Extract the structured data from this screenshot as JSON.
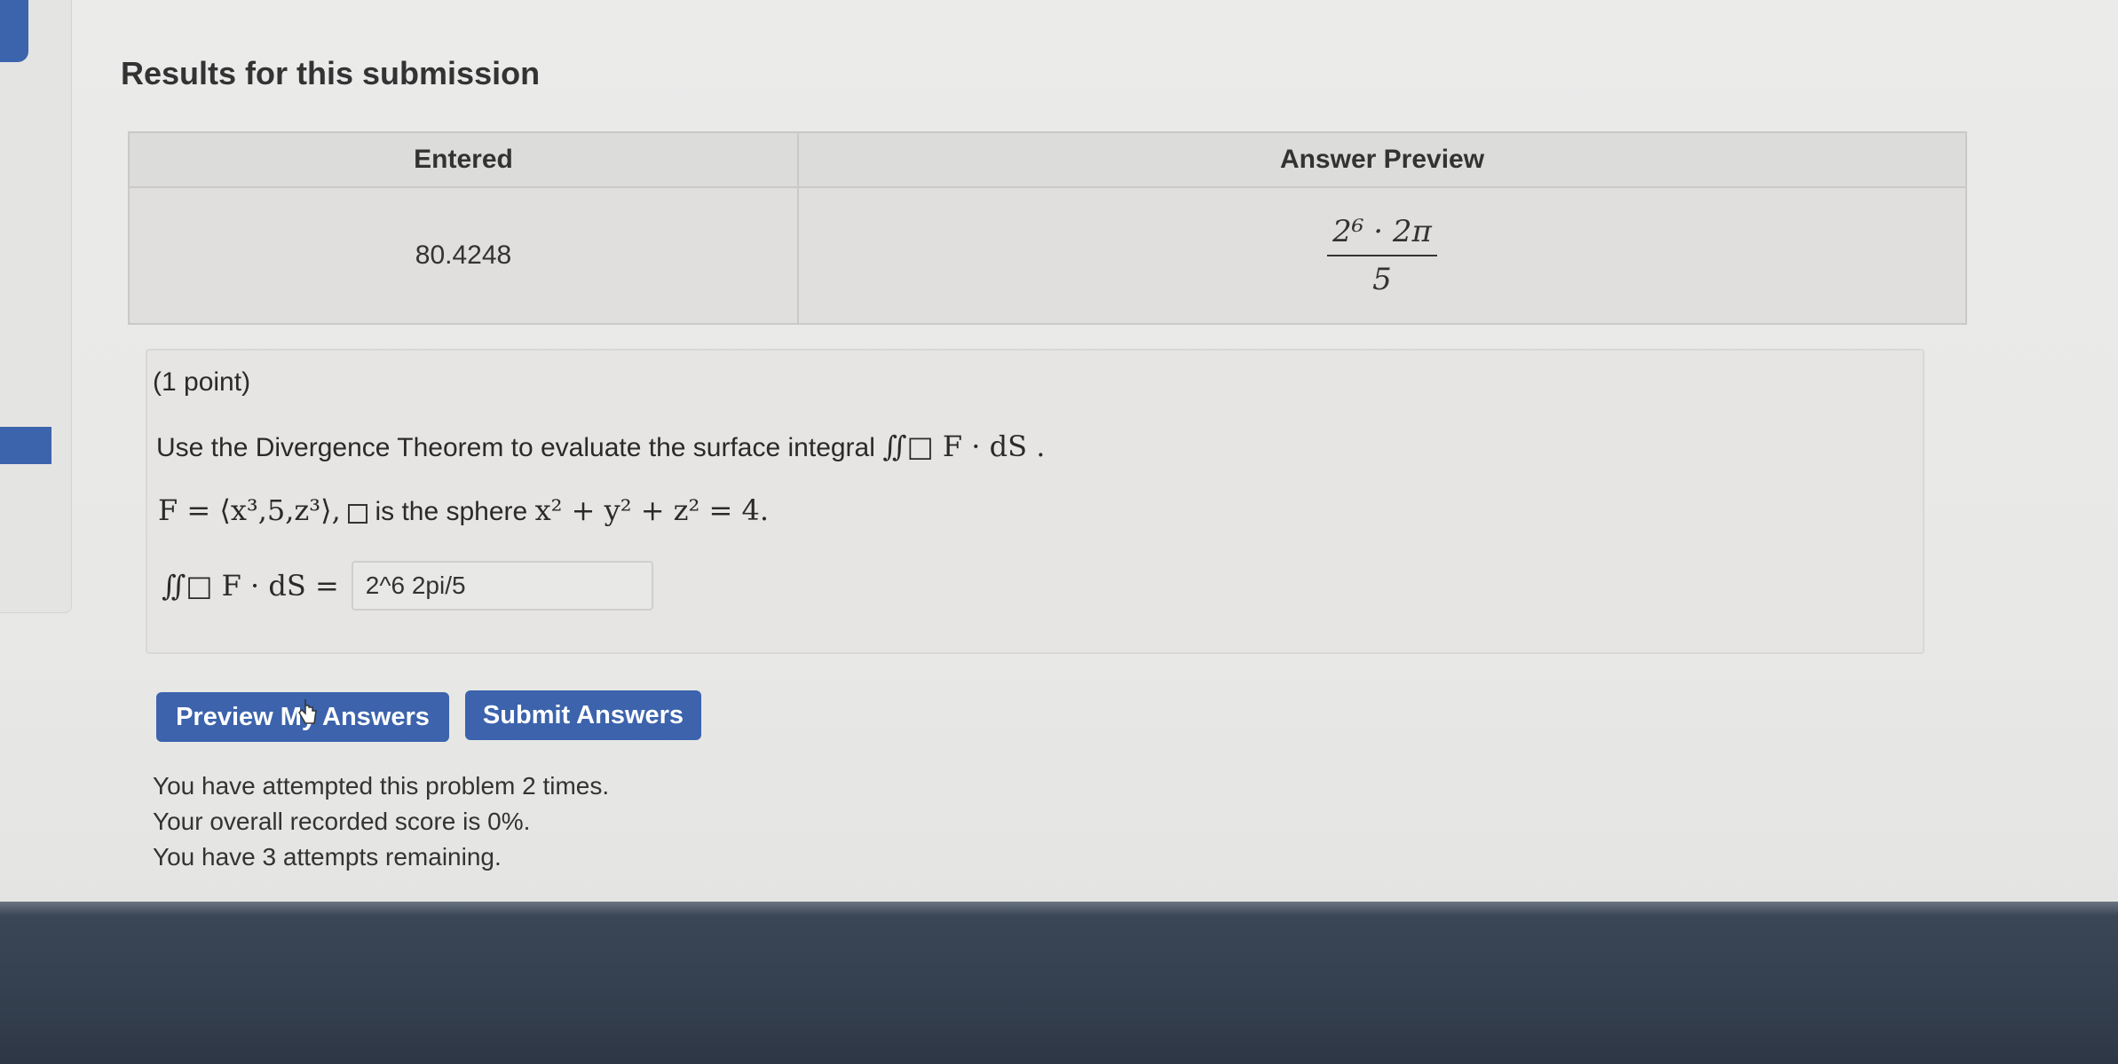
{
  "colors": {
    "accent": "#3c63ac",
    "bottom_bar": "#37424f"
  },
  "results": {
    "title": "Results for this submission",
    "headers": [
      "Entered",
      "Answer Preview"
    ],
    "entered": "80.4248",
    "preview_numerator": "2⁶ · 2π",
    "preview_denominator": "5"
  },
  "problem": {
    "points": "(1 point)",
    "instruction": "Use the Divergence Theorem to evaluate the surface integral",
    "integral_expression": "∬□ F · dS .",
    "field": "F = ⟨x³,5,z³⟩,",
    "sphere_text": "is the sphere",
    "sphere_equation": "x² + y² + z² = 4.",
    "answer_label": "∬□ F · dS =",
    "answer_value": "2^6 2pi/5"
  },
  "buttons": {
    "preview": "Preview My Answers",
    "submit": "Submit Answers"
  },
  "status": {
    "attempts": "You have attempted this problem 2 times.",
    "score": "Your overall recorded score is 0%.",
    "remaining": "You have 3 attempts remaining."
  }
}
